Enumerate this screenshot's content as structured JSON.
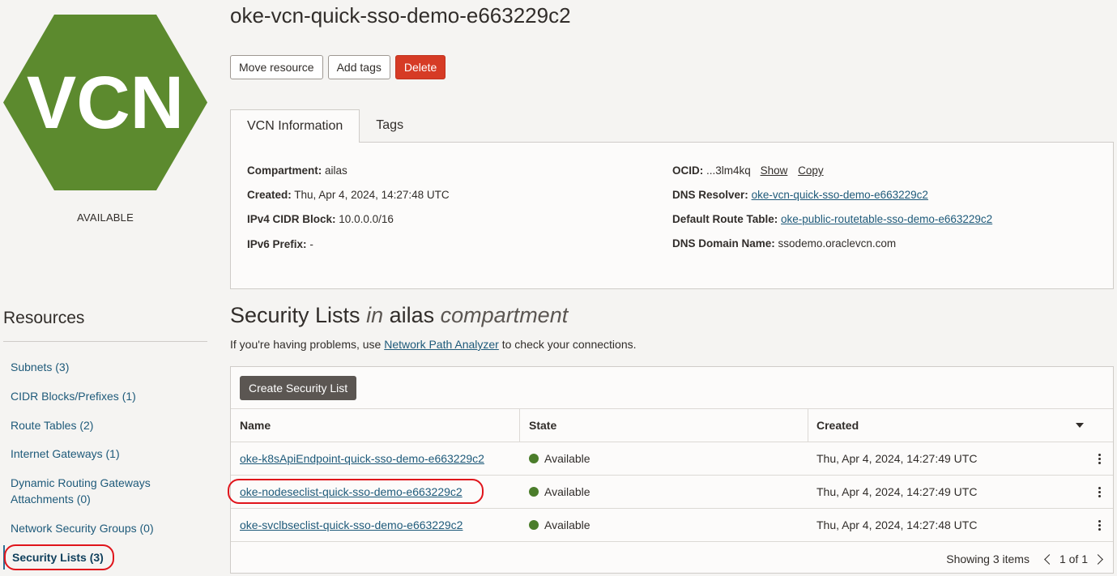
{
  "resource": {
    "icon_text": "VCN",
    "status": "AVAILABLE",
    "title": "oke-vcn-quick-sso-demo-e663229c2",
    "brand_color": "#5c8a2e"
  },
  "actions": {
    "move": "Move resource",
    "add_tags": "Add tags",
    "delete": "Delete"
  },
  "tabs": [
    {
      "label": "VCN Information",
      "active": true
    },
    {
      "label": "Tags",
      "active": false
    }
  ],
  "info": {
    "compartment_label": "Compartment:",
    "compartment": "ailas",
    "created_label": "Created:",
    "created": "Thu, Apr 4, 2024, 14:27:48 UTC",
    "ipv4_label": "IPv4 CIDR Block:",
    "ipv4": "10.0.0.0/16",
    "ipv6_label": "IPv6 Prefix:",
    "ipv6": "-",
    "ocid_label": "OCID:",
    "ocid": "...3lm4kq",
    "ocid_show": "Show",
    "ocid_copy": "Copy",
    "dns_resolver_label": "DNS Resolver:",
    "dns_resolver": "oke-vcn-quick-sso-demo-e663229c2",
    "route_table_label": "Default Route Table:",
    "route_table": "oke-public-routetable-sso-demo-e663229c2",
    "dns_domain_label": "DNS Domain Name:",
    "dns_domain": "ssodemo.oraclevcn.com"
  },
  "resources": {
    "title": "Resources",
    "items": [
      "Subnets (3)",
      "CIDR Blocks/Prefixes (1)",
      "Route Tables (2)",
      "Internet Gateways (1)",
      "Dynamic Routing Gateways Attachments (0)",
      "Network Security Groups (0)",
      "Security Lists (3)"
    ]
  },
  "section": {
    "title_main": "Security Lists",
    "title_in": "in",
    "title_compartment": "ailas",
    "title_suffix": "compartment",
    "help_prefix": "If you're having problems, use",
    "help_link": "Network Path Analyzer",
    "help_suffix": "to check your connections.",
    "create_button": "Create Security List"
  },
  "table": {
    "headers": [
      "Name",
      "State",
      "Created"
    ],
    "rows": [
      {
        "name": "oke-k8sApiEndpoint-quick-sso-demo-e663229c2",
        "state": "Available",
        "created": "Thu, Apr 4, 2024, 14:27:49 UTC"
      },
      {
        "name": "oke-nodeseclist-quick-sso-demo-e663229c2",
        "state": "Available",
        "created": "Thu, Apr 4, 2024, 14:27:49 UTC"
      },
      {
        "name": "oke-svclbseclist-quick-sso-demo-e663229c2",
        "state": "Available",
        "created": "Thu, Apr 4, 2024, 14:27:48 UTC"
      }
    ],
    "showing": "Showing 3 items",
    "pager": "1 of 1",
    "state_color": "#4b7d2b"
  }
}
